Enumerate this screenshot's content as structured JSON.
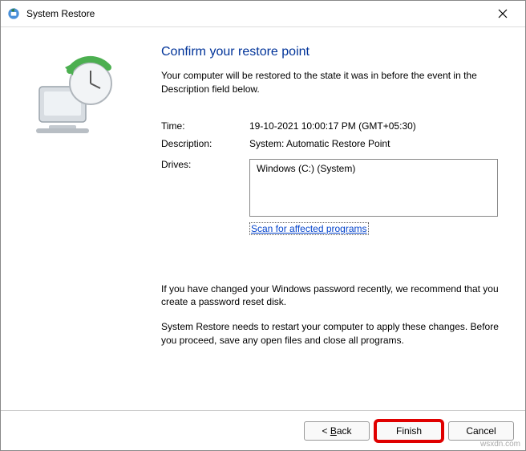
{
  "window": {
    "title": "System Restore"
  },
  "main": {
    "heading": "Confirm your restore point",
    "intro": "Your computer will be restored to the state it was in before the event in the Description field below.",
    "time_label": "Time:",
    "time_value": "19-10-2021 10:00:17 PM (GMT+05:30)",
    "description_label": "Description:",
    "description_value": "System: Automatic Restore Point",
    "drives_label": "Drives:",
    "drives_value": "Windows (C:) (System)",
    "scan_link": "Scan for affected programs",
    "note1": "If you have changed your Windows password recently, we recommend that you create a password reset disk.",
    "note2": "System Restore needs to restart your computer to apply these changes. Before you proceed, save any open files and close all programs."
  },
  "footer": {
    "back": "Back",
    "finish": "Finish",
    "cancel": "Cancel"
  },
  "watermark": "wsxdn.com"
}
